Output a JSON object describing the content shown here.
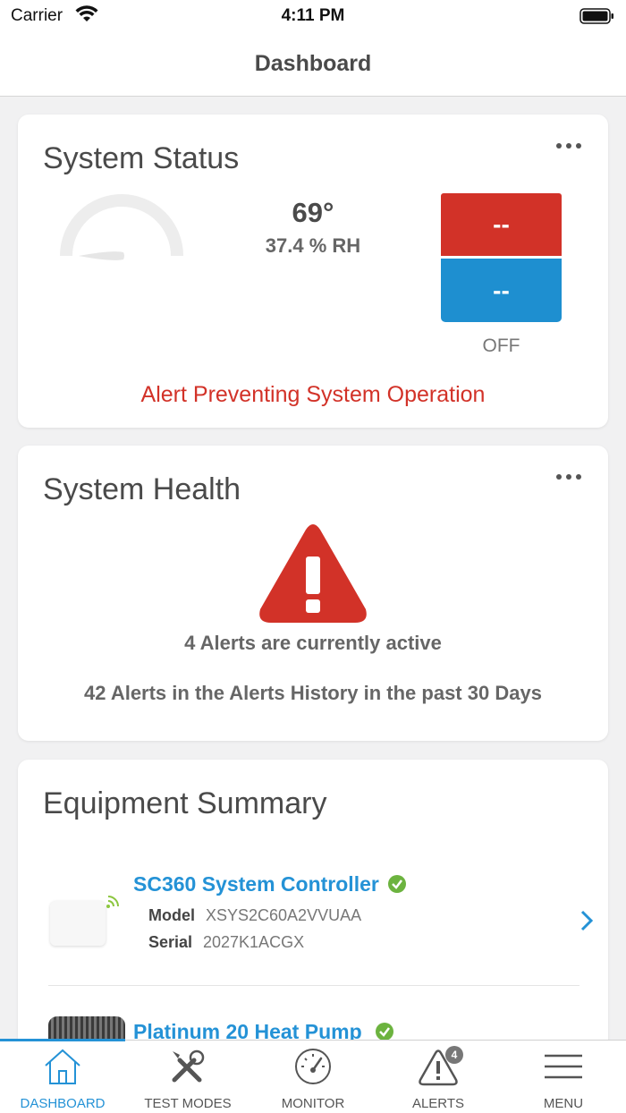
{
  "status_bar": {
    "carrier": "Carrier",
    "time": "4:11 PM"
  },
  "nav": {
    "title": "Dashboard"
  },
  "system_status": {
    "title": "System Status",
    "temperature": "69°",
    "humidity": "37.4 % RH",
    "heat_setpoint": "--",
    "cool_setpoint": "--",
    "mode": "OFF",
    "alert": "Alert Preventing System Operation",
    "colors": {
      "heat": "#d23228",
      "cool": "#1e8fd0"
    }
  },
  "system_health": {
    "title": "System Health",
    "active_alerts": "4 Alerts are currently active",
    "history_alerts": "42 Alerts in the Alerts History in the past 30 Days"
  },
  "equipment_summary": {
    "title": "Equipment Summary",
    "items": [
      {
        "name": "SC360 System Controller",
        "model_label": "Model",
        "model": "XSYS2C60A2VVUAA",
        "serial_label": "Serial",
        "serial": "2027K1ACGX",
        "status_icon": "check-circle-icon"
      },
      {
        "name": "Platinum 20 Heat Pump",
        "status_icon": "check-circle-icon"
      }
    ]
  },
  "tabs": [
    {
      "label": "DASHBOARD",
      "icon": "home-icon",
      "active": true
    },
    {
      "label": "TEST MODES",
      "icon": "tools-icon",
      "active": false
    },
    {
      "label": "MONITOR",
      "icon": "gauge-icon",
      "active": false
    },
    {
      "label": "ALERTS",
      "icon": "alert-icon",
      "active": false,
      "badge": "4"
    },
    {
      "label": "MENU",
      "icon": "menu-icon",
      "active": false
    }
  ],
  "accent_color": "#2492d6"
}
